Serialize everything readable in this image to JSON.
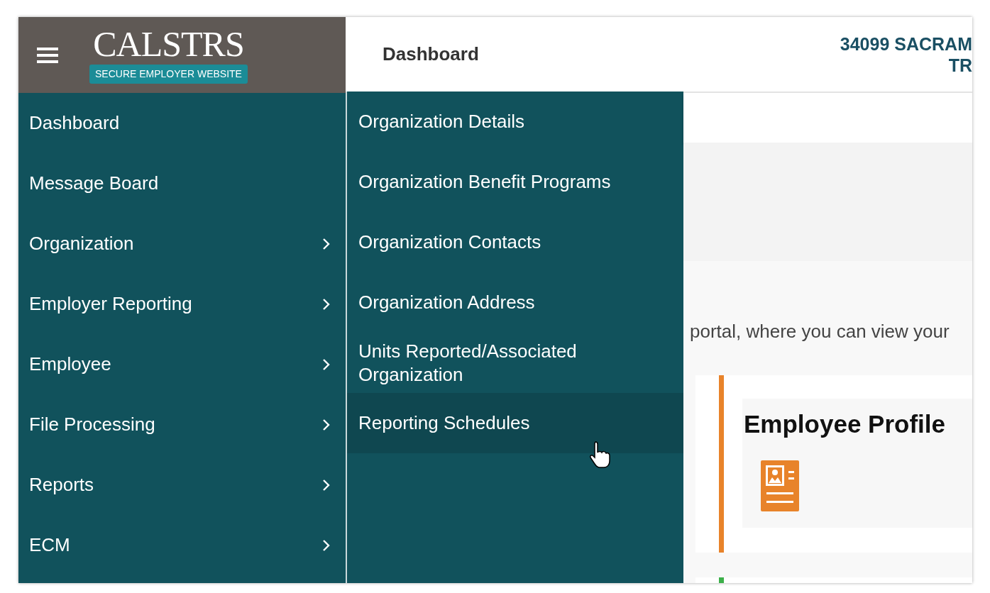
{
  "header": {
    "logo": {
      "name": "CALSTRS",
      "tagline": "SECURE EMPLOYER WEBSITE"
    },
    "page_title": "Dashboard",
    "organization": [
      "34099 SACRAM",
      "TR"
    ]
  },
  "menu": [
    {
      "label": "Dashboard",
      "has_submenu": false
    },
    {
      "label": "Message Board",
      "has_submenu": false
    },
    {
      "label": "Organization",
      "has_submenu": true
    },
    {
      "label": "Employer Reporting",
      "has_submenu": true
    },
    {
      "label": "Employee",
      "has_submenu": true
    },
    {
      "label": "File Processing",
      "has_submenu": true
    },
    {
      "label": "Reports",
      "has_submenu": true
    },
    {
      "label": "ECM",
      "has_submenu": true
    }
  ],
  "submenu": [
    {
      "label": "Organization Details",
      "selected": false
    },
    {
      "label": "Organization Benefit Programs",
      "selected": false
    },
    {
      "label": "Organization Contacts",
      "selected": false
    },
    {
      "label": "Organization Address",
      "selected": false
    },
    {
      "label": "Units Reported/Associated Organization",
      "selected": false
    },
    {
      "label": "Reporting Schedules",
      "selected": true
    }
  ],
  "main": {
    "intro": "portal, where you can view your",
    "cards": [
      {
        "title": "Employee Profile",
        "color": "#e8832a"
      },
      {
        "color": "#3cb04a"
      }
    ]
  }
}
